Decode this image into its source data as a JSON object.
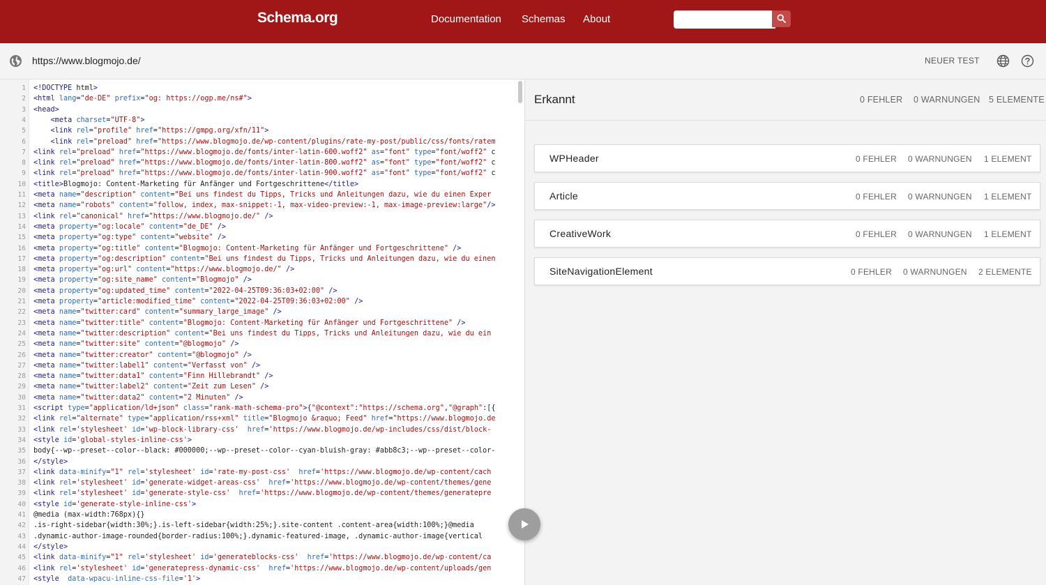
{
  "brand": {
    "logo": "Schema.org"
  },
  "nav": {
    "documentation": "Documentation",
    "schemas": "Schemas",
    "about": "About"
  },
  "search": {
    "placeholder": ""
  },
  "urlbar": {
    "url": "https://www.blogmojo.de/",
    "new_test": "NEUER TEST"
  },
  "results": {
    "title": "Erkannt",
    "errors": "0 FEHLER",
    "warnings": "0 WARNUNGEN",
    "elements": "5 ELEMENTE",
    "items": [
      {
        "name": "WPHeader",
        "errors": "0 FEHLER",
        "warnings": "0 WARNUNGEN",
        "elements": "1 ELEMENT"
      },
      {
        "name": "Article",
        "errors": "0 FEHLER",
        "warnings": "0 WARNUNGEN",
        "elements": "1 ELEMENT"
      },
      {
        "name": "CreativeWork",
        "errors": "0 FEHLER",
        "warnings": "0 WARNUNGEN",
        "elements": "1 ELEMENT"
      },
      {
        "name": "SiteNavigationElement",
        "errors": "0 FEHLER",
        "warnings": "0 WARNUNGEN",
        "elements": "2 ELEMENTE"
      }
    ]
  },
  "code_lines": [
    "<!DOCTYPE html>",
    "<html lang=\"de-DE\" prefix=\"og: https://ogp.me/ns#\">",
    "<head>",
    "    <meta charset=\"UTF-8\">",
    "    <link rel=\"profile\" href=\"https://gmpg.org/xfn/11\">",
    "    <link rel=\"preload\" href=\"https://www.blogmojo.de/wp-content/plugins/rate-my-post/public/css/fonts/ratem",
    "<link rel=\"preload\" href=\"https://www.blogmojo.de/fonts/inter-latin-600.woff2\" as=\"font\" type=\"font/woff2\" c",
    "<link rel=\"preload\" href=\"https://www.blogmojo.de/fonts/inter-latin-800.woff2\" as=\"font\" type=\"font/woff2\" c",
    "<link rel=\"preload\" href=\"https://www.blogmojo.de/fonts/inter-latin-900.woff2\" as=\"font\" type=\"font/woff2\" c",
    "<title>Blogmojo: Content-Marketing für Anfänger und Fortgeschrittene</title>",
    "<meta name=\"description\" content=\"Bei uns findest du Tipps, Tricks und Anleitungen dazu, wie du einen Exper",
    "<meta name=\"robots\" content=\"follow, index, max-snippet:-1, max-video-preview:-1, max-image-preview:large\"/>",
    "<link rel=\"canonical\" href=\"https://www.blogmojo.de/\" />",
    "<meta property=\"og:locale\" content=\"de_DE\" />",
    "<meta property=\"og:type\" content=\"website\" />",
    "<meta property=\"og:title\" content=\"Blogmojo: Content-Marketing für Anfänger und Fortgeschrittene\" />",
    "<meta property=\"og:description\" content=\"Bei uns findest du Tipps, Tricks und Anleitungen dazu, wie du einen",
    "<meta property=\"og:url\" content=\"https://www.blogmojo.de/\" />",
    "<meta property=\"og:site_name\" content=\"Blogmojo\" />",
    "<meta property=\"og:updated_time\" content=\"2022-04-25T09:36:03+02:00\" />",
    "<meta property=\"article:modified_time\" content=\"2022-04-25T09:36:03+02:00\" />",
    "<meta name=\"twitter:card\" content=\"summary_large_image\" />",
    "<meta name=\"twitter:title\" content=\"Blogmojo: Content-Marketing für Anfänger und Fortgeschrittene\" />",
    "<meta name=\"twitter:description\" content=\"Bei uns findest du Tipps, Tricks und Anleitungen dazu, wie du ein",
    "<meta name=\"twitter:site\" content=\"@blogmojo\" />",
    "<meta name=\"twitter:creator\" content=\"@blogmojo\" />",
    "<meta name=\"twitter:label1\" content=\"Verfasst von\" />",
    "<meta name=\"twitter:data1\" content=\"Finn Hillebrandt\" />",
    "<meta name=\"twitter:label2\" content=\"Zeit zum Lesen\" />",
    "<meta name=\"twitter:data2\" content=\"2 Minuten\" />",
    "<script type=\"application/ld+json\" class=\"rank-math-schema-pro\">{\"@context\":\"https://schema.org\",\"@graph\":[{",
    "<link rel=\"alternate\" type=\"application/rss+xml\" title=\"Blogmojo &raquo; Feed\" href=\"https://www.blogmojo.de",
    "<link rel='stylesheet' id='wp-block-library-css'  href='https://www.blogmojo.de/wp-includes/css/dist/block-",
    "<style id='global-styles-inline-css'>",
    "body{--wp--preset--color--black: #000000;--wp--preset--color--cyan-bluish-gray: #abb8c3;--wp--preset--color-",
    "</style>",
    "<link data-minify=\"1\" rel='stylesheet' id='rate-my-post-css'  href='https://www.blogmojo.de/wp-content/cach",
    "<link rel='stylesheet' id='generate-widget-areas-css'  href='https://www.blogmojo.de/wp-content/themes/gene",
    "<link rel='stylesheet' id='generate-style-css'  href='https://www.blogmojo.de/wp-content/themes/generatepre",
    "<style id='generate-style-inline-css'>",
    "@media (max-width:768px){}",
    ".is-right-sidebar{width:30%;}.is-left-sidebar{width:25%;}.site-content .content-area{width:100%;}@media",
    ".dynamic-author-image-rounded{border-radius:100%;}.dynamic-featured-image, .dynamic-author-image{vertical",
    "</style>",
    "<link data-minify=\"1\" rel='stylesheet' id='generateblocks-css'  href='https://www.blogmojo.de/wp-content/ca",
    "<link rel='stylesheet' id='generatepress-dynamic-css'  href='https://www.blogmojo.de/wp-content/uploads/gen",
    "<style  data-wpacu-inline-css-file='1'>"
  ],
  "line_numbers": [
    "1",
    "2",
    "3",
    "4",
    "5",
    "6",
    "7",
    "8",
    "9",
    "10",
    "11",
    "12",
    "13",
    "14",
    "15",
    "16",
    "17",
    "18",
    "19",
    "20",
    "21",
    "22",
    "23",
    "24",
    "25",
    "26",
    "27",
    "28",
    "29",
    "30",
    "31",
    "32",
    "33",
    "34",
    "35",
    "36",
    "37",
    "38",
    "39",
    "40",
    "41",
    "42",
    "43",
    "44",
    "45",
    "46",
    "47"
  ],
  "colors": {
    "brand_red": "#a11717",
    "panel_bg": "#f3f3f3"
  },
  "icons": [
    "search-icon",
    "globe-icon",
    "language-icon",
    "help-icon",
    "play-icon"
  ]
}
